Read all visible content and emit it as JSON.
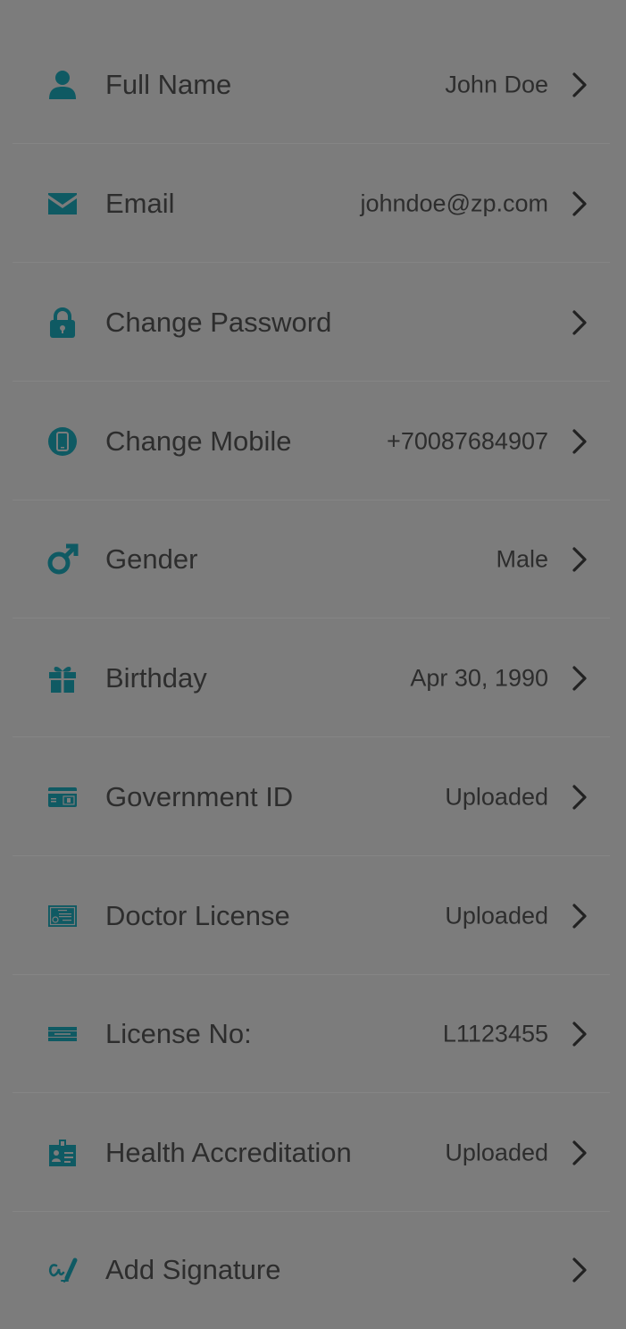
{
  "colors": {
    "background": "#7c7c7c",
    "icon_accent": "#0f5a63",
    "text": "#2d2d2d",
    "divider": "#858585"
  },
  "rows": [
    {
      "label": "Full Name",
      "value": "John Doe",
      "icon": "person-icon"
    },
    {
      "label": "Email",
      "value": "johndoe@zp.com",
      "icon": "envelope-icon"
    },
    {
      "label": "Change Password",
      "value": "",
      "icon": "lock-icon"
    },
    {
      "label": "Change Mobile",
      "value": "+70087684907",
      "icon": "mobile-icon"
    },
    {
      "label": "Gender",
      "value": "Male",
      "icon": "male-icon"
    },
    {
      "label": "Birthday",
      "value": "Apr 30, 1990",
      "icon": "gift-icon"
    },
    {
      "label": "Government ID",
      "value": "Uploaded",
      "icon": "id-card-icon"
    },
    {
      "label": "Doctor License",
      "value": "Uploaded",
      "icon": "certificate-icon"
    },
    {
      "label": "License No:",
      "value": "L1123455",
      "icon": "license-plate-icon"
    },
    {
      "label": "Health Accreditation",
      "value": "Uploaded",
      "icon": "badge-icon"
    },
    {
      "label": "Add Signature",
      "value": "",
      "icon": "signature-icon"
    }
  ]
}
